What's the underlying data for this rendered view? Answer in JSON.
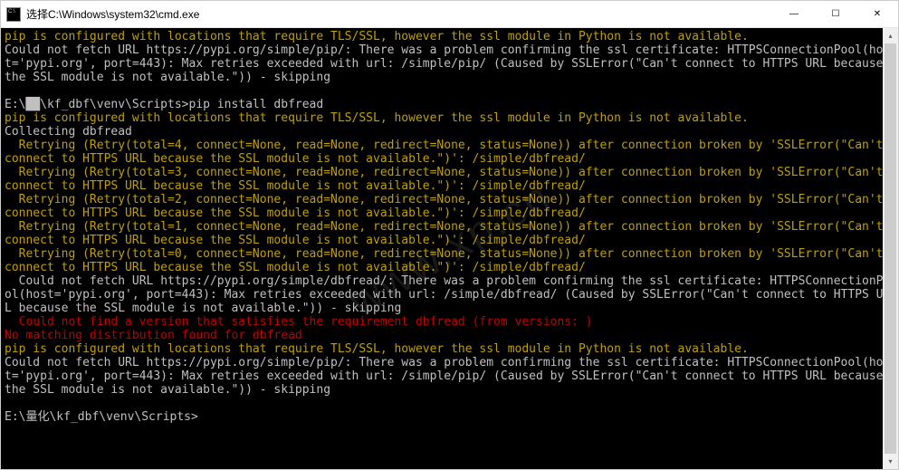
{
  "titlebar": {
    "text": "选择C:\\Windows\\system32\\cmd.exe"
  },
  "controls": {
    "minimize": "—",
    "maximize": "☐",
    "close": "✕"
  },
  "terminal": {
    "lines": [
      {
        "cls": "yellow",
        "text": "pip is configured with locations that require TLS/SSL, however the ssl module in Python is not available."
      },
      {
        "cls": "white",
        "text": "Could not fetch URL https://pypi.org/simple/pip/: There was a problem confirming the ssl certificate: HTTPSConnectionPool(host='pypi.org', port=443): Max retries exceeded with url: /simple/pip/ (Caused by SSLError(\"Can't connect to HTTPS URL because the SSL module is not available.\")) - skipping"
      },
      {
        "cls": "white",
        "text": " "
      },
      {
        "cls": "prompt",
        "text": "E:\\██\\kf_dbf\\venv\\Scripts>pip install dbfread"
      },
      {
        "cls": "yellow",
        "text": "pip is configured with locations that require TLS/SSL, however the ssl module in Python is not available."
      },
      {
        "cls": "white",
        "text": "Collecting dbfread"
      },
      {
        "cls": "yellow",
        "text": "  Retrying (Retry(total=4, connect=None, read=None, redirect=None, status=None)) after connection broken by 'SSLError(\"Can't connect to HTTPS URL because the SSL module is not available.\")': /simple/dbfread/"
      },
      {
        "cls": "yellow",
        "text": "  Retrying (Retry(total=3, connect=None, read=None, redirect=None, status=None)) after connection broken by 'SSLError(\"Can't connect to HTTPS URL because the SSL module is not available.\")': /simple/dbfread/"
      },
      {
        "cls": "yellow",
        "text": "  Retrying (Retry(total=2, connect=None, read=None, redirect=None, status=None)) after connection broken by 'SSLError(\"Can't connect to HTTPS URL because the SSL module is not available.\")': /simple/dbfread/"
      },
      {
        "cls": "yellow",
        "text": "  Retrying (Retry(total=1, connect=None, read=None, redirect=None, status=None)) after connection broken by 'SSLError(\"Can't connect to HTTPS URL because the SSL module is not available.\")': /simple/dbfread/"
      },
      {
        "cls": "yellow",
        "text": "  Retrying (Retry(total=0, connect=None, read=None, redirect=None, status=None)) after connection broken by 'SSLError(\"Can't connect to HTTPS URL because the SSL module is not available.\")': /simple/dbfread/"
      },
      {
        "cls": "white",
        "text": "  Could not fetch URL https://pypi.org/simple/dbfread/: There was a problem confirming the ssl certificate: HTTPSConnectionPool(host='pypi.org', port=443): Max retries exceeded with url: /simple/dbfread/ (Caused by SSLError(\"Can't connect to HTTPS URL because the SSL module is not available.\")) - skipping"
      },
      {
        "cls": "red",
        "text": "  Could not find a version that satisfies the requirement dbfread (from versions: )"
      },
      {
        "cls": "red",
        "text": "No matching distribution found for dbfread"
      },
      {
        "cls": "yellow",
        "text": "pip is configured with locations that require TLS/SSL, however the ssl module in Python is not available."
      },
      {
        "cls": "white",
        "text": "Could not fetch URL https://pypi.org/simple/pip/: There was a problem confirming the ssl certificate: HTTPSConnectionPool(host='pypi.org', port=443): Max retries exceeded with url: /simple/pip/ (Caused by SSLError(\"Can't connect to HTTPS URL because the SSL module is not available.\")) - skipping"
      },
      {
        "cls": "white",
        "text": " "
      },
      {
        "cls": "prompt",
        "text": "E:\\量化\\kf_dbf\\venv\\Scripts>"
      }
    ]
  },
  "watermark": "www.xp.cn"
}
